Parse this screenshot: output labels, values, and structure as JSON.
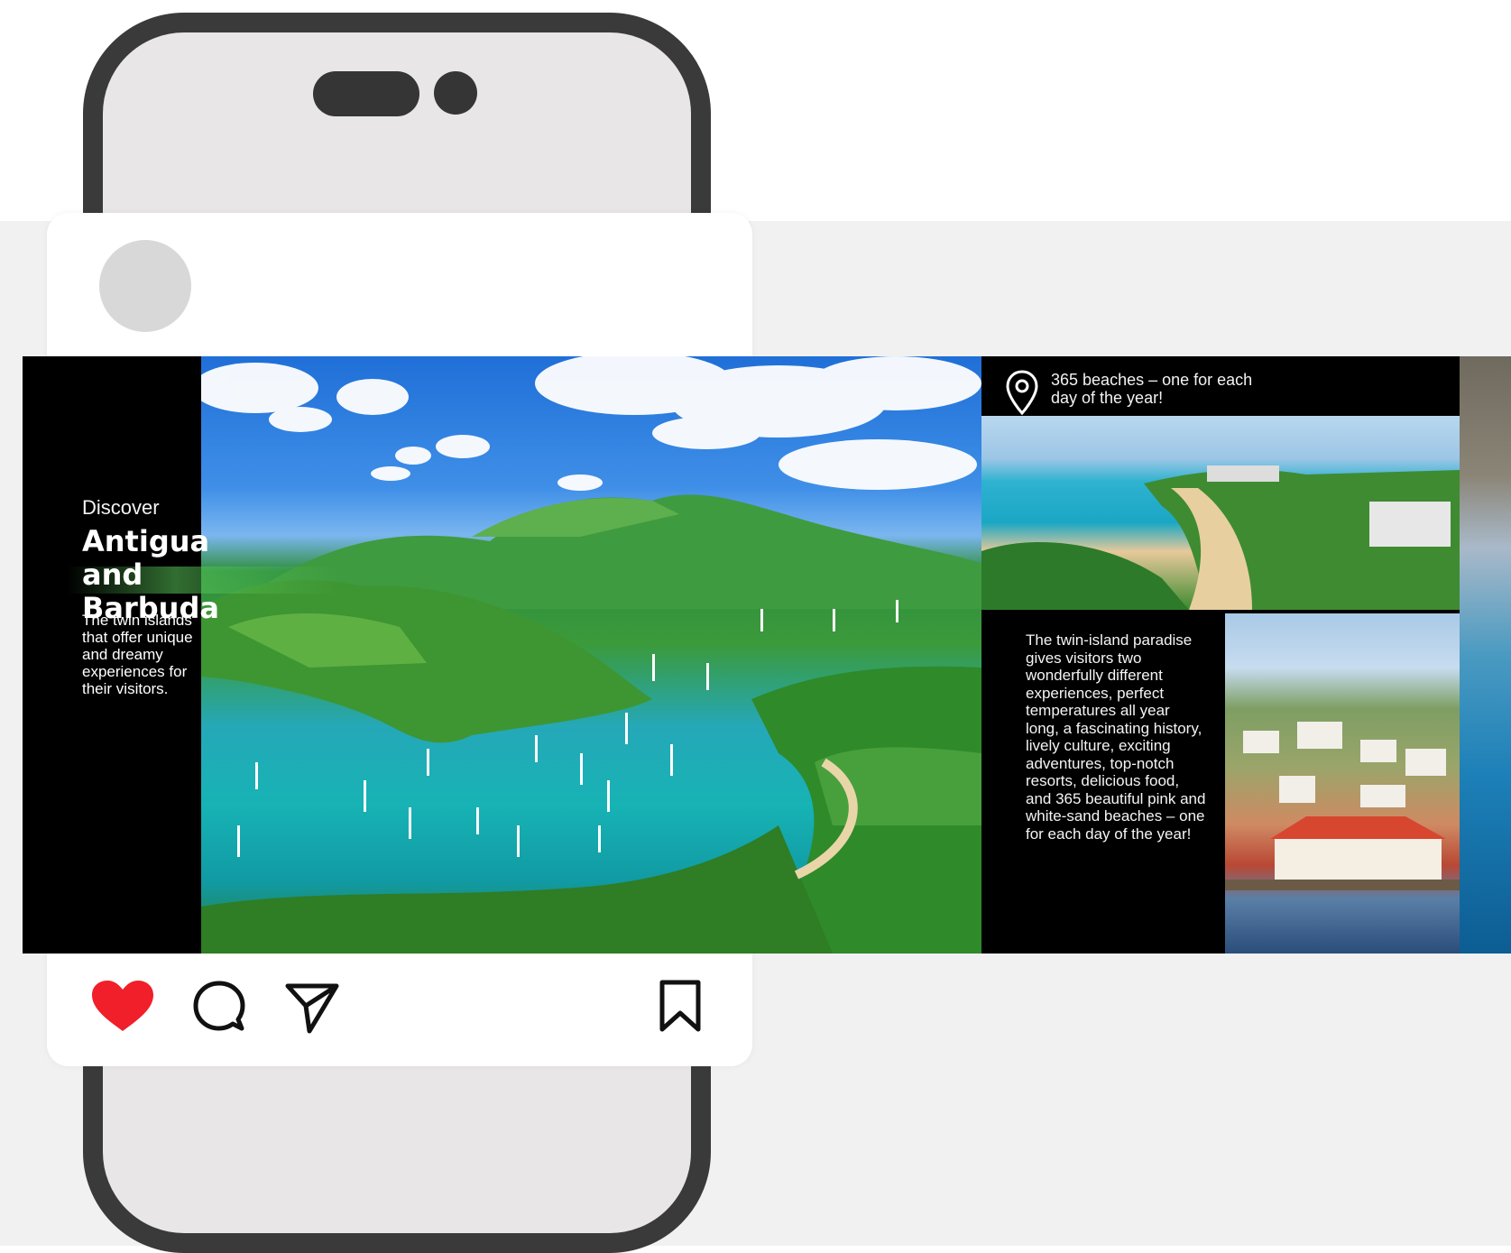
{
  "post": {
    "slide1": {
      "discover": "Discover",
      "title": "Antigua and\nBarbuda",
      "lead": "The twin islands that offer unique and dreamy experiences for their visitors."
    },
    "slide2": {
      "headline": "365 beaches – one for each day of the year!",
      "body": "The twin-island paradise gives visitors two wonderfully different experiences, perfect temperatures all year long, a fascinating history, lively culture, exciting adventures, top-notch resorts, delicious food, and 365 beautiful pink and white-sand beaches – one for each day of the year!"
    }
  },
  "icons": {
    "like": "heart-icon",
    "comment": "comment-icon",
    "share": "send-icon",
    "save": "bookmark-icon",
    "location": "location-pin-icon"
  },
  "colors": {
    "like": "#f01f2a",
    "phone_frame": "#3a3a3a",
    "background": "#f1f1f1"
  }
}
